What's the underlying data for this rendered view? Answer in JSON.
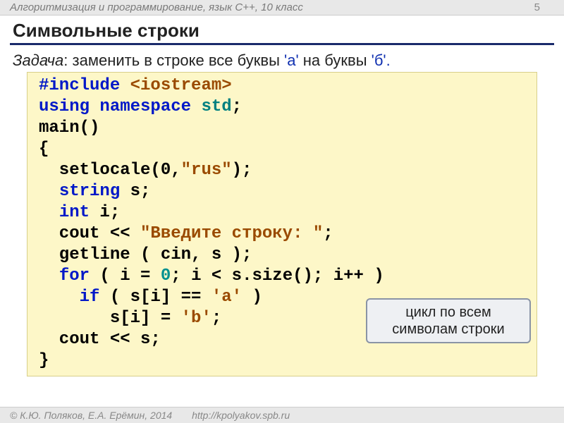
{
  "header": {
    "course": "Алгоритмизация и программирование, язык С++, 10 класс",
    "page": "5"
  },
  "title": "Символьные строки",
  "task": {
    "label": "Задача",
    "text": ": заменить в строке все буквы ",
    "lit1": "'а'",
    "mid": " на буквы ",
    "lit2": "'б'."
  },
  "code": {
    "l1a": "#include ",
    "l1b": "<iostream>",
    "l2a": "using ",
    "l2b": "namespace ",
    "l2c": "std",
    "l2d": ";",
    "l3": "main()",
    "l4": "{",
    "l5a": "  setlocale(0,",
    "l5b": "\"rus\"",
    "l5c": ");",
    "l6a": "  ",
    "l6b": "string",
    "l6c": " s;",
    "l7a": "  ",
    "l7b": "int",
    "l7c": " i;",
    "l8a": "  cout << ",
    "l8b": "\"Введите строку: \"",
    "l8c": ";",
    "l9": "  getline ( cin, s );",
    "l10a": "  ",
    "l10b": "for",
    "l10c": " ( i = ",
    "l10d": "0",
    "l10e": "; i < s.size(); i++ )",
    "l11a": "    ",
    "l11b": "if",
    "l11c": " ( s[i] == ",
    "l11d": "'a'",
    "l11e": " )",
    "l12a": "       s[i] = ",
    "l12b": "'b'",
    "l12c": ";",
    "l13": "  cout << s;",
    "l14": "}"
  },
  "callout": "цикл по всем символам строки",
  "footer": {
    "copyright": "© К.Ю. Поляков, Е.А. Ерёмин, 2014",
    "url": "http://kpolyakov.spb.ru"
  }
}
